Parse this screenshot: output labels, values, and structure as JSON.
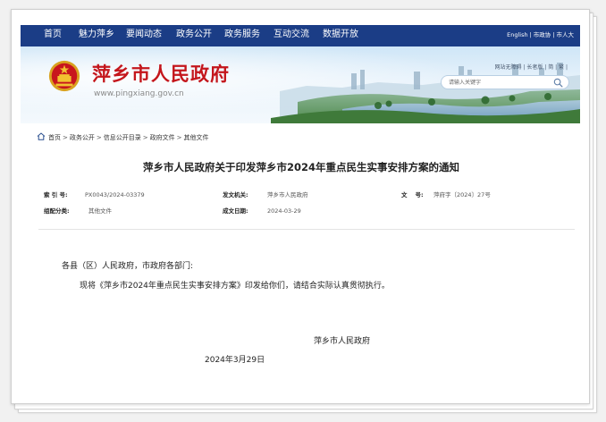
{
  "nav": {
    "items": [
      "首页",
      "魅力萍乡",
      "要闻动态",
      "政务公开",
      "政务服务",
      "互动交流",
      "数据开放"
    ],
    "right_links": [
      "English",
      "市政协",
      "市人大"
    ],
    "background": "#1b3d86"
  },
  "header": {
    "site_title": "萍乡市人民政府",
    "site_url": "www.pingxiang.gov.cn",
    "util_links": [
      "网站无障碍",
      "长者版",
      "简",
      "繁"
    ],
    "search_placeholder": "请输入关键字",
    "title_color": "#c4161c"
  },
  "breadcrumb": [
    "首页",
    "政务公开",
    "信息公开目录",
    "政府文件",
    "其他文件"
  ],
  "document": {
    "title": "萍乡市人民政府关于印发萍乡市2024年重点民生实事安排方案的通知",
    "meta": {
      "index_label": "索 引 号:",
      "index_value": "PX0043/2024-03379",
      "issuer_label": "发文机关:",
      "issuer_value": "萍乡市人民政府",
      "docno_label": "文    号:",
      "docno_value": "萍府字〔2024〕27号",
      "category_label": "组配分类:",
      "category_value": "其他文件",
      "date_label": "成文日期:",
      "date_value": "2024-03-29"
    },
    "salutation": "各县（区）人民政府，市政府各部门:",
    "body": "现将《萍乡市2024年重点民生实事安排方案》印发给你们，请结合实际认真贯彻执行。",
    "signature": "萍乡市人民政府",
    "date": "2024年3月29日"
  }
}
